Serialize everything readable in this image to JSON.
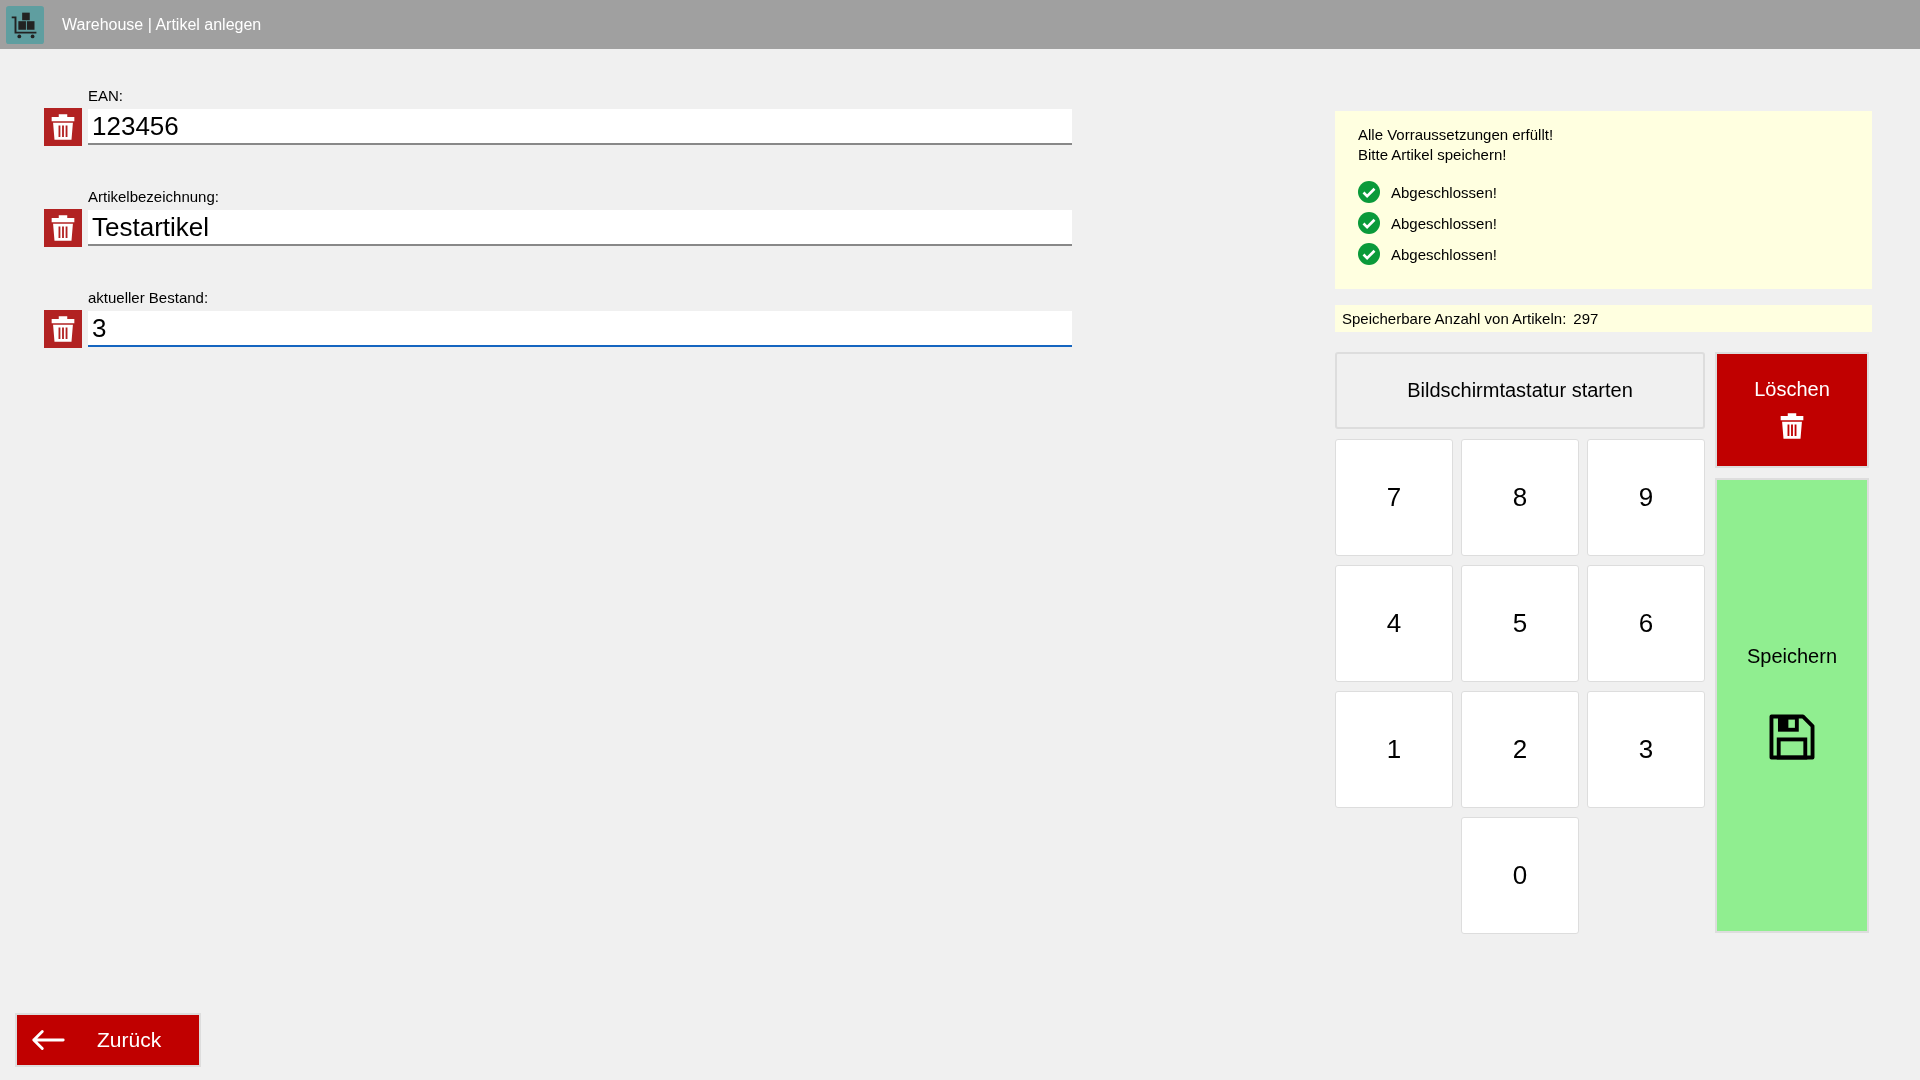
{
  "window": {
    "title": "Warehouse | Artikel anlegen"
  },
  "fields": [
    {
      "label": "EAN:",
      "value": "123456",
      "focused": false
    },
    {
      "label": "Artikelbezeichnung:",
      "value": "Testartikel",
      "focused": false
    },
    {
      "label": "aktueller Bestand:",
      "value": "3",
      "focused": true
    }
  ],
  "status": {
    "lines": [
      "Alle Vorraussetzungen erfüllt!",
      "Bitte Artikel speichern!"
    ],
    "checks": [
      {
        "label": "Abgeschlossen!",
        "done": true
      },
      {
        "label": "Abgeschlossen!",
        "done": true
      },
      {
        "label": "Abgeschlossen!",
        "done": true
      }
    ]
  },
  "capacity": {
    "label": "Speicherbare Anzahl von Artikeln:",
    "value": "297"
  },
  "keyboard_button": "Bildschirmtastatur starten",
  "delete_button": "Löschen",
  "save_button": "Speichern",
  "keypad": [
    "7",
    "8",
    "9",
    "4",
    "5",
    "6",
    "1",
    "2",
    "3",
    "0"
  ],
  "back_button": "Zurück"
}
